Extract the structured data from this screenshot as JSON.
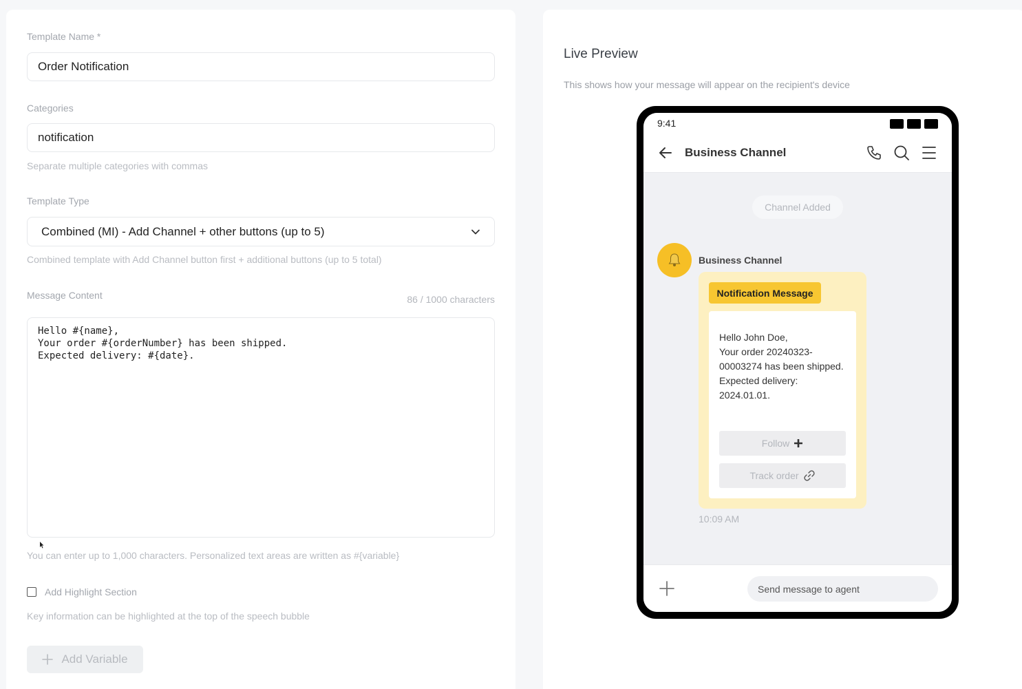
{
  "form": {
    "template_name_label": "Template Name *",
    "template_name_value": "Order Notification",
    "categories_label": "Categories",
    "categories_value": "notification",
    "categories_help": "Separate multiple categories with commas",
    "template_type_label": "Template Type",
    "template_type_value": "Combined (MI) - Add Channel + other buttons (up to 5)",
    "template_type_help": "Combined template with Add Channel button first + additional buttons (up to 5 total)",
    "message_label": "Message Content",
    "char_count": "86 / 1000 characters",
    "message_value": "Hello #{name},\nYour order #{orderNumber} has been shipped.\nExpected delivery: #{date}.",
    "message_help": "You can enter up to 1,000 characters. Personalized text areas are written as #{variable}",
    "highlight_label": "Add Highlight Section",
    "highlight_help": "Key information can be highlighted at the top of the speech bubble",
    "add_variable_label": "Add Variable"
  },
  "preview": {
    "title": "Live Preview",
    "subtitle": "This shows how your message will appear on the recipient's device",
    "status_time": "9:41",
    "header_title": "Business Channel",
    "system_message": "Channel Added",
    "sender_name": "Business Channel",
    "tag": "Notification Message",
    "message_text": "Hello John Doe,\nYour order 20240323-00003274 has been shipped.\nExpected delivery: 2024.01.01.",
    "buttons": [
      {
        "label": "Follow",
        "icon": "plus-icon"
      },
      {
        "label": "Track order",
        "icon": "link-icon"
      }
    ],
    "time": "10:09 AM",
    "input_placeholder": "Send message to agent"
  },
  "colors": {
    "accent_yellow": "#f7c631",
    "bubble_bg": "#fdf0c1",
    "avatar_bg": "#f6bf26"
  }
}
